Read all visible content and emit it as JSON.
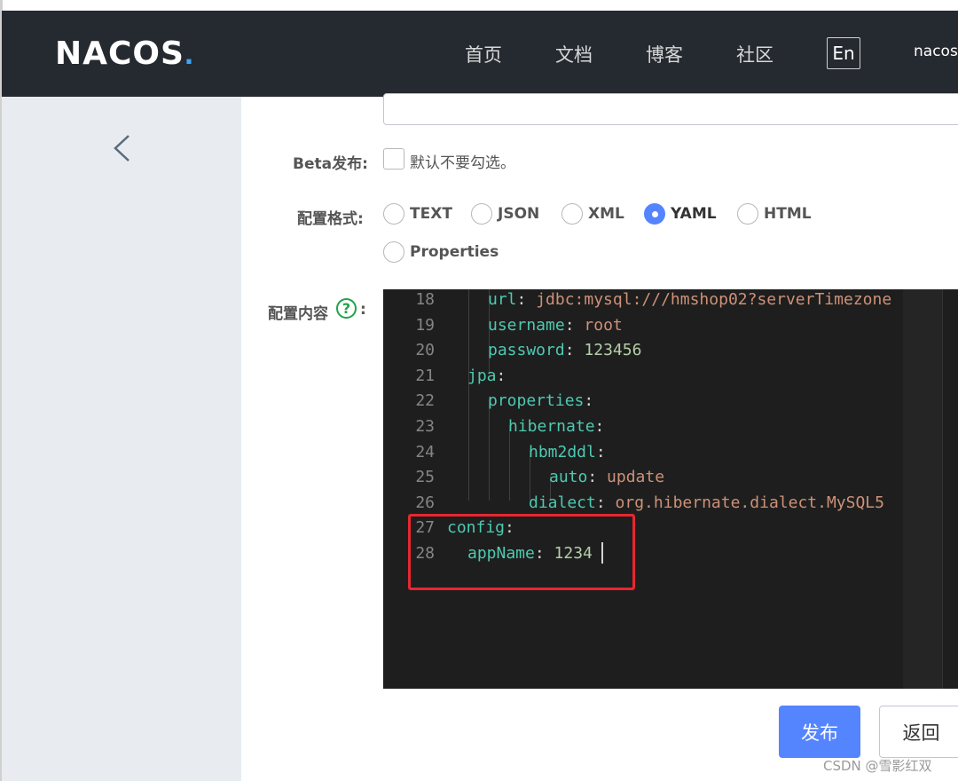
{
  "header": {
    "logo_text": "NACOS",
    "logo_dot": ".",
    "nav": [
      "首页",
      "文档",
      "博客",
      "社区"
    ],
    "lang": "En",
    "user": "nacos"
  },
  "form": {
    "beta_label": "Beta发布:",
    "beta_checkbox_text": "默认不要勾选。",
    "format_label": "配置格式:",
    "formats": [
      "TEXT",
      "JSON",
      "XML",
      "YAML",
      "HTML",
      "Properties"
    ],
    "selected_format": "YAML",
    "content_label": "配置内容",
    "content_colon": ":",
    "help_icon_text": "?"
  },
  "editor": {
    "lines": [
      {
        "num": "18",
        "key": "url",
        "sep": ": ",
        "val": "jdbc:mysql:///hmshop02?serverTimezone",
        "val_type": "s"
      },
      {
        "num": "19",
        "key": "username",
        "sep": ": ",
        "val": "root",
        "val_type": "s"
      },
      {
        "num": "20",
        "key": "password",
        "sep": ": ",
        "val": "123456",
        "val_type": "n"
      },
      {
        "num": "21",
        "key": "jpa",
        "sep": ":",
        "val": "",
        "val_type": "s"
      },
      {
        "num": "22",
        "key": "properties",
        "sep": ":",
        "val": "",
        "val_type": "s"
      },
      {
        "num": "23",
        "key": "hibernate",
        "sep": ":",
        "val": "",
        "val_type": "s"
      },
      {
        "num": "24",
        "key": "hbm2ddl",
        "sep": ":",
        "val": "",
        "val_type": "s"
      },
      {
        "num": "25",
        "key": "auto",
        "sep": ": ",
        "val": "update",
        "val_type": "s"
      },
      {
        "num": "26",
        "key": "dialect",
        "sep": ": ",
        "val": "org.hibernate.dialect.MySQL5",
        "val_type": "s"
      },
      {
        "num": "27",
        "key": "config",
        "sep": ":",
        "val": "",
        "val_type": "s"
      },
      {
        "num": "28",
        "key": "appName",
        "sep": ": ",
        "val": "1234",
        "val_type": "n"
      }
    ]
  },
  "buttons": {
    "publish": "发布",
    "back": "返回"
  },
  "watermark": "CSDN @雪影红双"
}
